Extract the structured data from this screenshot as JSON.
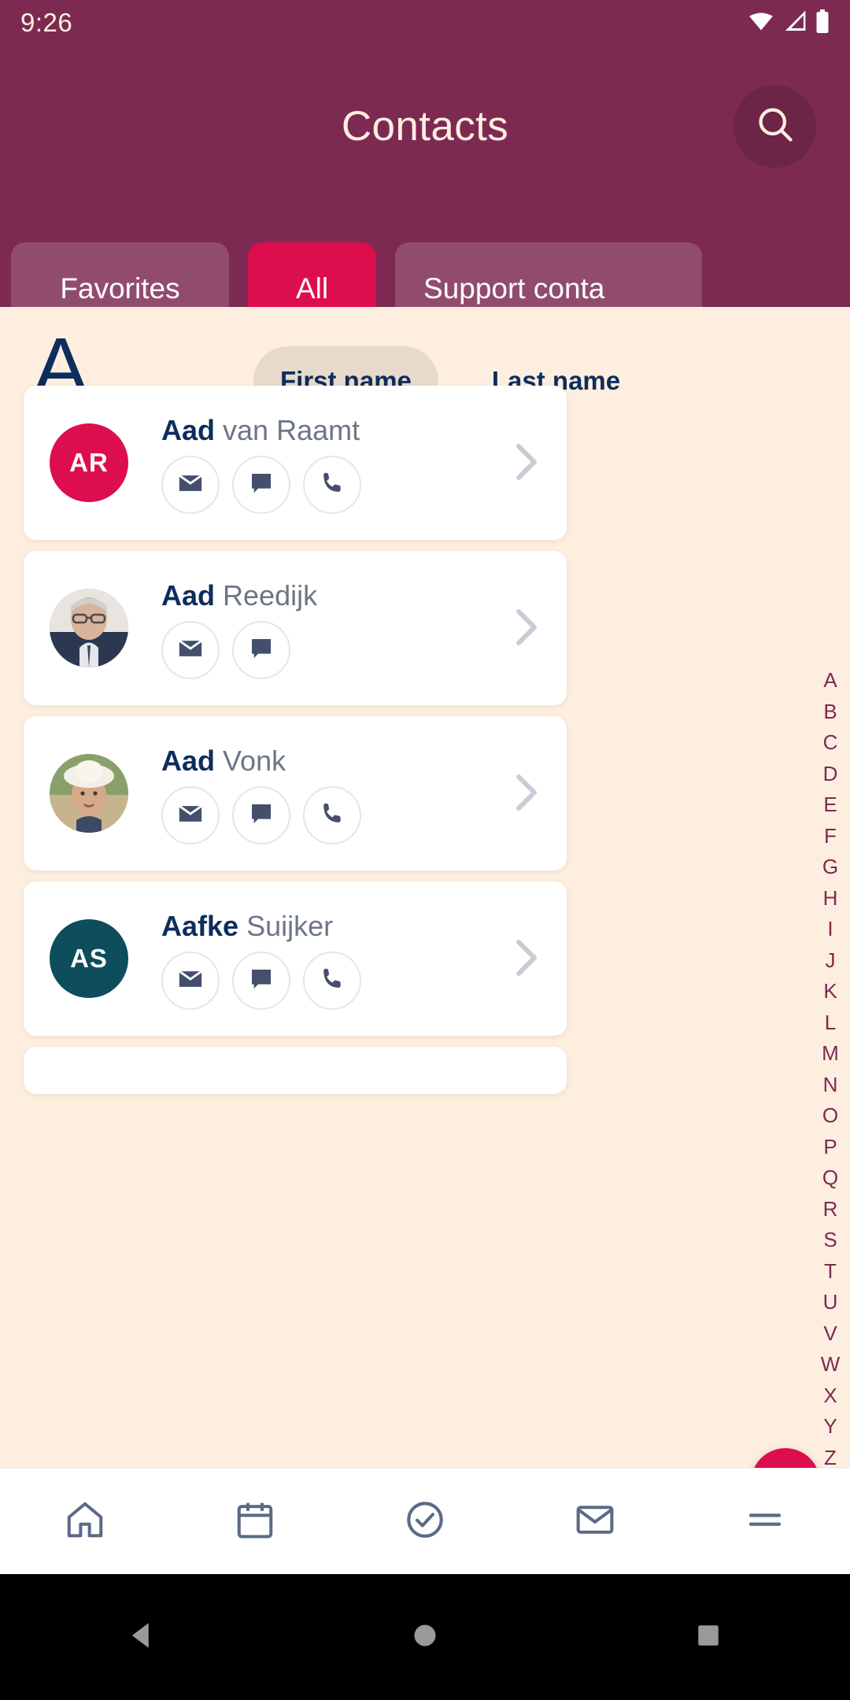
{
  "status_bar": {
    "time": "9:26",
    "icons": [
      "wifi-icon",
      "cellular-signal-icon",
      "battery-icon"
    ]
  },
  "app_bar": {
    "title": "Contacts",
    "search_icon": "search-icon"
  },
  "tabs": [
    {
      "label": "Favorites",
      "selected": false
    },
    {
      "label": "All",
      "selected": true
    },
    {
      "label": "Support conta",
      "selected": false
    }
  ],
  "section": {
    "letter": "A"
  },
  "sort": {
    "options": [
      {
        "label": "First name",
        "selected": true
      },
      {
        "label": "Last name",
        "selected": false
      }
    ]
  },
  "contacts": [
    {
      "first_name": "Aad",
      "last_name": "van Raamt",
      "initials": "AR",
      "avatar_type": "initials",
      "avatar_color": "#dd0e4e",
      "actions": [
        "email-icon",
        "message-icon",
        "phone-icon"
      ]
    },
    {
      "first_name": "Aad",
      "last_name": "Reedijk",
      "initials": "",
      "avatar_type": "photo",
      "avatar_color": "#8d96a3",
      "actions": [
        "email-icon",
        "message-icon"
      ]
    },
    {
      "first_name": "Aad",
      "last_name": "Vonk",
      "initials": "",
      "avatar_type": "photo",
      "avatar_color": "#a8a07f",
      "actions": [
        "email-icon",
        "message-icon",
        "phone-icon"
      ]
    },
    {
      "first_name": "Aafke",
      "last_name": "Suijker",
      "initials": "AS",
      "avatar_type": "initials",
      "avatar_color": "#0d4d5c",
      "actions": [
        "email-icon",
        "message-icon",
        "phone-icon"
      ]
    }
  ],
  "alphabet_index": [
    "A",
    "B",
    "C",
    "D",
    "E",
    "F",
    "G",
    "H",
    "I",
    "J",
    "K",
    "L",
    "M",
    "N",
    "O",
    "P",
    "Q",
    "R",
    "S",
    "T",
    "U",
    "V",
    "W",
    "X",
    "Y",
    "Z"
  ],
  "fab": {
    "icon": "chat-bubbles-icon"
  },
  "bottom_nav": [
    {
      "icon": "home-icon"
    },
    {
      "icon": "calendar-icon"
    },
    {
      "icon": "check-circle-icon"
    },
    {
      "icon": "mail-icon"
    },
    {
      "icon": "menu-icon"
    }
  ],
  "system_nav": [
    {
      "icon": "back-triangle-icon"
    },
    {
      "icon": "home-circle-icon"
    },
    {
      "icon": "recents-square-icon"
    }
  ],
  "colors": {
    "header": "#7d2a52",
    "accent": "#dd0e4e",
    "background": "#fdeee0",
    "card": "#ffffff",
    "text_primary": "#0d2d5c",
    "text_secondary": "#6d7685"
  }
}
